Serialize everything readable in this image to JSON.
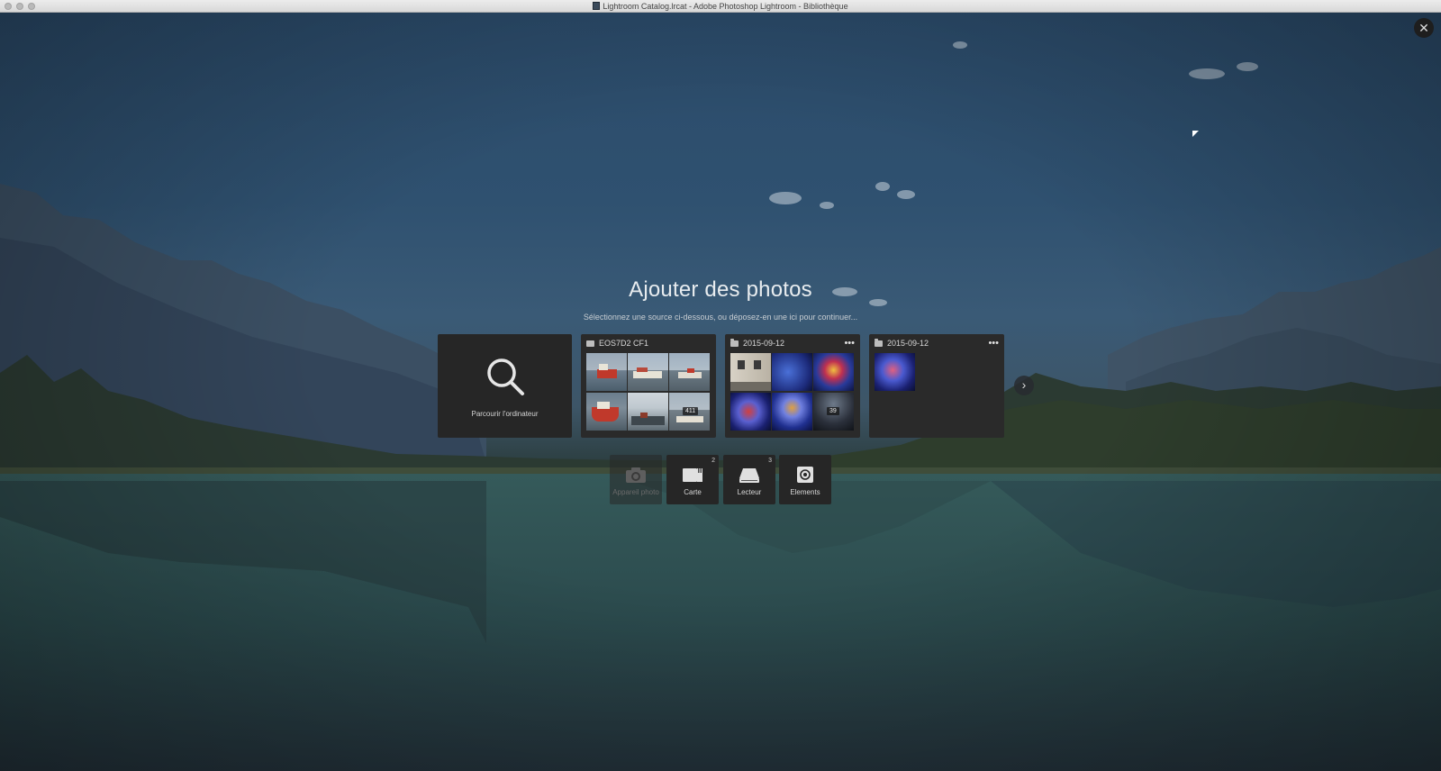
{
  "window": {
    "title": "Lightroom Catalog.lrcat - Adobe Photoshop Lightroom - Bibliothèque"
  },
  "import": {
    "heading": "Ajouter des photos",
    "subheading": "Sélectionnez une source ci-dessous, ou déposez-en une ici pour continuer...",
    "browse_label": "Parcourir l'ordinateur",
    "sources": [
      {
        "label": "EOS7D2 CF1",
        "icon": "card-icon",
        "more": "",
        "count": "411"
      },
      {
        "label": "2015-09-12",
        "icon": "folder-icon",
        "more": "•••",
        "count": "39"
      },
      {
        "label": "2015-09-12",
        "icon": "folder-icon",
        "more": "•••",
        "count": ""
      }
    ],
    "next_icon": "chevron-right-icon",
    "close_icon": "close-icon"
  },
  "devices": [
    {
      "label": "Appareil photo",
      "badge": "",
      "icon": "camera-icon",
      "enabled": false
    },
    {
      "label": "Carte",
      "badge": "2",
      "icon": "memory-card-icon",
      "enabled": true
    },
    {
      "label": "Lecteur",
      "badge": "3",
      "icon": "drive-icon",
      "enabled": true
    },
    {
      "label": "Elements",
      "badge": "",
      "icon": "elements-icon",
      "enabled": true
    }
  ],
  "colors": {
    "card_bg": "#2a2a2a",
    "text": "#e8ecef"
  }
}
